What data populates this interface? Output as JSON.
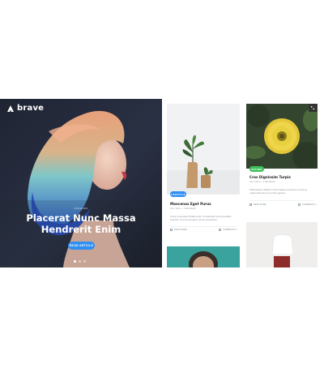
{
  "hero": {
    "logo_text": "brave",
    "category": "FASHION",
    "title_line1": "Placerat Nunc Massa",
    "title_line2": "Hendrerit Enim",
    "button_label": "READ ARTICLE",
    "slides_count": 3,
    "active_slide": 1
  },
  "cards": [
    {
      "badge": "LIFESTYLE",
      "badge_color": "#2f8ff2",
      "title": "Maecenas Eget Purus",
      "meta": "JULY 2019  —  3 MIN READ",
      "excerpt": "Fusce consequat fringilla porta. Ut sollicitudin elit sed facilisis interdum. Sed at nisl eget mi porta consectetur.",
      "read_more": "READ MORE",
      "comments": "COMMENTS 4"
    },
    {
      "badge": "NATURE",
      "badge_color": "#3fbf5a",
      "title": "Cras Dignissim Turpis",
      "meta": "JULY 2019  —  2 MIN READ",
      "excerpt": "Pellentesque habitant morbi tristique senectus et netus et malesuada fames ac turpis egestas.",
      "read_more": "READ MORE",
      "comments": "COMMENTS 2"
    }
  ],
  "colors": {
    "accent": "#2f8ff2",
    "nature": "#3fbf5a",
    "hero_bg": "#252b3b"
  },
  "icons": [
    "logo-mark-icon",
    "toggle-icon",
    "read-more-icon",
    "comments-icon"
  ]
}
